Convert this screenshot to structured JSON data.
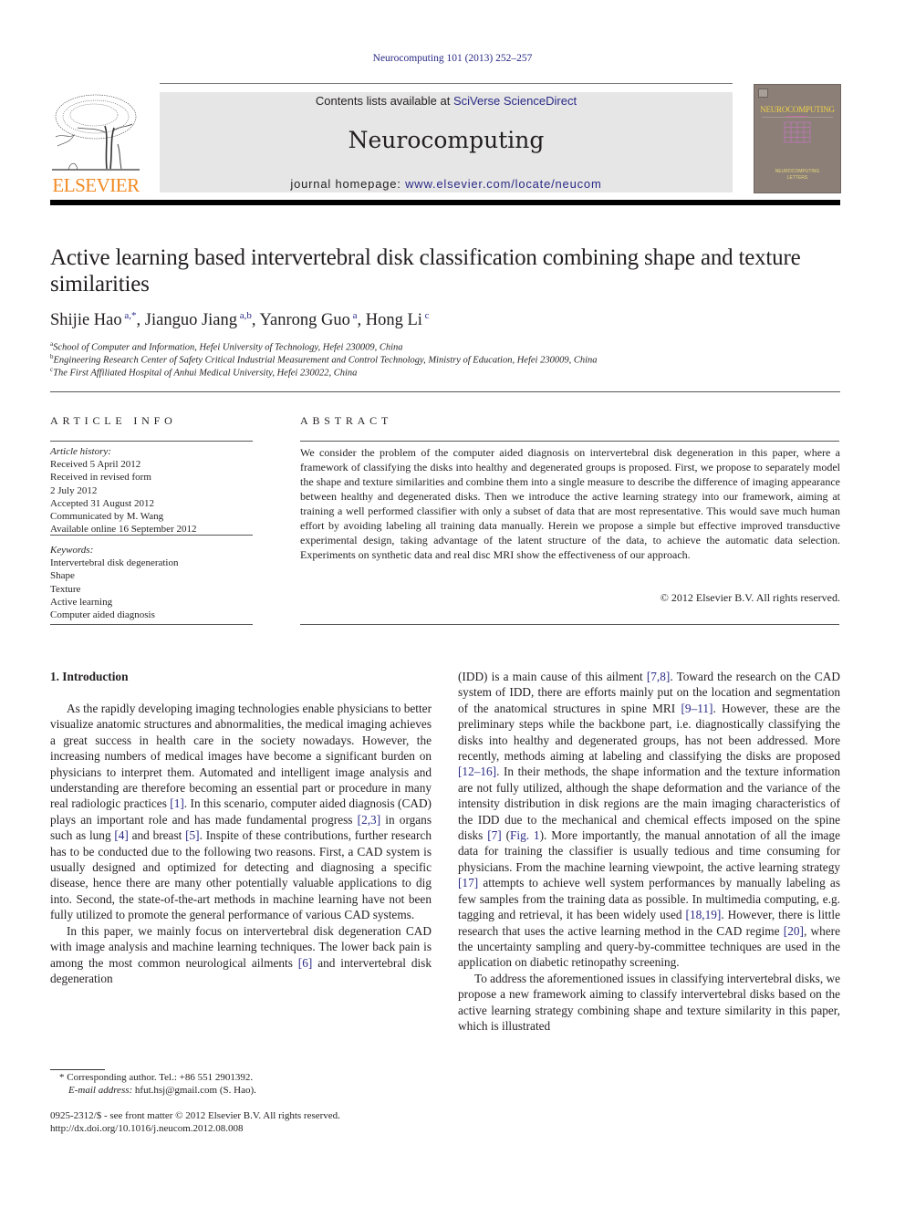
{
  "header": {
    "citation": "Neurocomputing 101 (2013) 252–257",
    "contents_prefix": "Contents lists available at ",
    "contents_link": "SciVerse ScienceDirect",
    "journal_name": "Neurocomputing",
    "homepage_prefix": "journal homepage: ",
    "homepage_link": "www.elsevier.com/locate/neucom",
    "publisher_logo_text": "ELSEVIER",
    "cover_title": "NEUROCOMPUTING",
    "cover_footer_line1": "NEUROCOMPUTING",
    "cover_footer_line2": "LETTERS",
    "colors": {
      "link": "#2a2a86",
      "elsevier_orange": "#f28a22",
      "banner_bg": "#e6e6e6",
      "cover_bg": "#8b7f78"
    }
  },
  "article": {
    "title": "Active learning based intervertebral disk classification combining shape and texture similarities",
    "authors": [
      {
        "name": "Shijie Hao",
        "sup": "a,*",
        "sep": ", "
      },
      {
        "name": "Jianguo Jiang",
        "sup": "a,b",
        "sep": ", "
      },
      {
        "name": "Yanrong Guo",
        "sup": "a",
        "sep": ", "
      },
      {
        "name": "Hong Li",
        "sup": "c",
        "sep": ""
      }
    ],
    "affiliations": [
      {
        "sup": "a",
        "text": "School of Computer and Information, Hefei University of Technology, Hefei 230009, China"
      },
      {
        "sup": "b",
        "text": "Engineering Research Center of Safety Critical Industrial Measurement and Control Technology, Ministry of Education, Hefei 230009, China"
      },
      {
        "sup": "c",
        "text": "The First Affiliated Hospital of Anhui Medical University, Hefei 230022, China"
      }
    ]
  },
  "article_info": {
    "heading": "ARTICLE INFO",
    "history_label": "Article history:",
    "history": [
      "Received 5 April 2012",
      "Received in revised form",
      "2 July 2012",
      "Accepted 31 August 2012",
      "Communicated by M. Wang",
      "Available online 16 September 2012"
    ],
    "keywords_label": "Keywords:",
    "keywords": [
      "Intervertebral disk degeneration",
      "Shape",
      "Texture",
      "Active learning",
      "Computer aided diagnosis"
    ]
  },
  "abstract": {
    "heading": "ABSTRACT",
    "text": "We consider the problem of the computer aided diagnosis on intervertebral disk degeneration in this paper, where a framework of classifying the disks into healthy and degenerated groups is proposed. First, we propose to separately model the shape and texture similarities and combine them into a single measure to describe the difference of imaging appearance between healthy and degenerated disks. Then we introduce the active learning strategy into our framework, aiming at training a well performed classifier with only a subset of data that are most representative. This would save much human effort by avoiding labeling all training data manually. Herein we propose a simple but effective improved transductive experimental design, taking advantage of the latent structure of the data, to achieve the automatic data selection. Experiments on synthetic data and real disc MRI show the effectiveness of our approach.",
    "copyright": "© 2012 Elsevier B.V. All rights reserved."
  },
  "body": {
    "section_heading": "1.  Introduction",
    "left_paragraphs": [
      [
        {
          "t": "As the rapidly developing imaging technologies enable physicians to better visualize anatomic structures and abnormalities, the medical imaging achieves a great success in health care in the society nowadays. However, the increasing numbers of medical images have become a significant burden on physicians to interpret them. Automated and intelligent image analysis and understanding are therefore becoming an essential part or procedure in many real radiologic practices "
        },
        {
          "ref": "[1]"
        },
        {
          "t": ". In this scenario, computer aided diagnosis (CAD) plays an important role and has made fundamental progress "
        },
        {
          "ref": "[2,3]"
        },
        {
          "t": " in organs such as lung "
        },
        {
          "ref": "[4]"
        },
        {
          "t": " and breast "
        },
        {
          "ref": "[5]"
        },
        {
          "t": ". Inspite of these contributions, further research has to be conducted due to the following two reasons. First, a CAD system is usually designed and optimized for detecting and diagnosing a specific disease, hence there are many other potentially valuable applications to dig into. Second, the state-of-the-art methods in machine learning have not been fully utilized to promote the general performance of various CAD systems."
        }
      ],
      [
        {
          "t": "In this paper, we mainly focus on intervertebral disk degeneration CAD with image analysis and machine learning techniques. The lower back pain is among the most common neurological ailments "
        },
        {
          "ref": "[6]"
        },
        {
          "t": " and intervertebral disk degeneration"
        }
      ]
    ],
    "right_paragraphs": [
      [
        {
          "t": "(IDD) is a main cause of this ailment "
        },
        {
          "ref": "[7,8]"
        },
        {
          "t": ". Toward the research on the CAD system of IDD, there are efforts mainly put on the location and segmentation of the anatomical structures in spine MRI "
        },
        {
          "ref": "[9–11]"
        },
        {
          "t": ". However, these are the preliminary steps while the backbone part, i.e. diagnostically classifying the disks into healthy and degenerated groups, has not been addressed. More recently, methods aiming at labeling and classifying the disks are proposed "
        },
        {
          "ref": "[12–16]"
        },
        {
          "t": ". In their methods, the shape information and the texture information are not fully utilized, although the shape deformation and the variance of the intensity distribution in disk regions are the main imaging characteristics of the IDD due to the mechanical and chemical effects imposed on the spine disks "
        },
        {
          "ref": "[7]"
        },
        {
          "t": " ("
        },
        {
          "ref": "Fig. 1"
        },
        {
          "t": "). More importantly, the manual annotation of all the image data for training the classifier is usually tedious and time consuming for physicians. From the machine learning viewpoint, the active learning strategy "
        },
        {
          "ref": "[17]"
        },
        {
          "t": " attempts to achieve well system performances by manually labeling as few samples from the training data as possible. In multimedia computing, e.g. tagging and retrieval, it has been widely used "
        },
        {
          "ref": "[18,19]"
        },
        {
          "t": ". However, there is little research that uses the active learning method in the CAD regime "
        },
        {
          "ref": "[20]"
        },
        {
          "t": ", where the uncertainty sampling and query-by-committee techniques are used in the application on diabetic retinopathy screening."
        }
      ],
      [
        {
          "t": "To address the aforementioned issues in classifying intervertebral disks, we propose a new framework aiming to classify intervertebral disks based on the active learning strategy combining shape and texture similarity in this paper, which is illustrated"
        }
      ]
    ]
  },
  "footnotes": {
    "corresponding": "* Corresponding author. Tel.: +86 551 2901392.",
    "email_label": "E-mail address:",
    "email_value": " hfut.hsj@gmail.com (S. Hao).",
    "issn": "0925-2312/$ - see front matter © 2012 Elsevier B.V. All rights reserved.",
    "doi": "http://dx.doi.org/10.1016/j.neucom.2012.08.008"
  }
}
